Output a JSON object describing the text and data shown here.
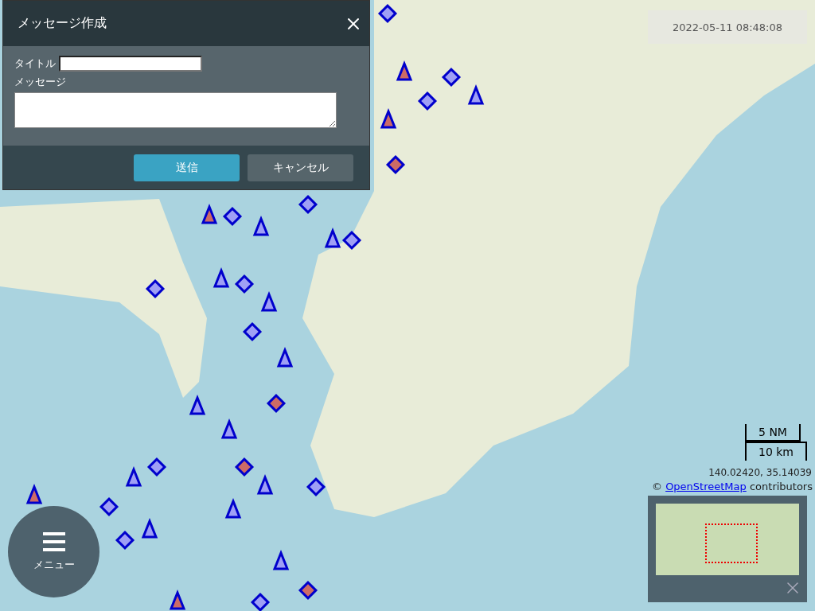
{
  "dialog": {
    "title": "メッセージ作成",
    "title_label": "タイトル",
    "message_label": "メッセージ",
    "buttons": [
      {
        "label": "送信",
        "kind": "primary"
      },
      {
        "label": "キャンセル",
        "kind": "secondary"
      }
    ]
  },
  "timestamp": "2022-05-11 08:48:08",
  "scale": {
    "nautical": "5 NM",
    "metric": "10 km"
  },
  "coordinates": "140.02420, 35.14039",
  "attribution": {
    "prefix": "©",
    "link": "OpenStreetMap",
    "suffix": "contributors"
  },
  "menu": {
    "label": "メニュー"
  }
}
